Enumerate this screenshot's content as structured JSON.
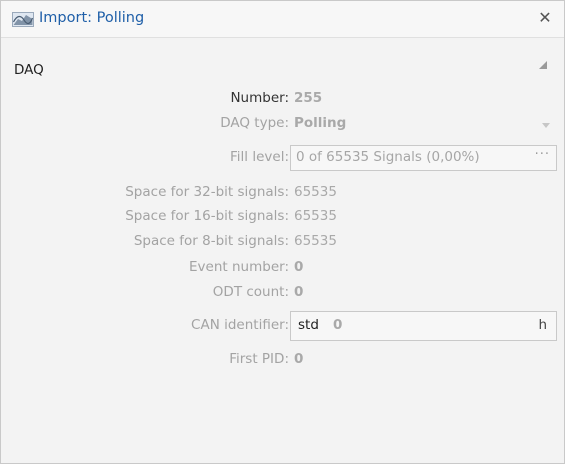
{
  "window": {
    "title": "Import: Polling",
    "close_icon": "close-icon",
    "title_icon": "import-waveform-icon"
  },
  "section": {
    "title": "DAQ",
    "collapse_icon": "collapse-triangle-icon"
  },
  "fields": {
    "number": {
      "label": "Number:",
      "value": "255"
    },
    "daq_type": {
      "label": "DAQ type:",
      "value": "Polling"
    },
    "fill_level": {
      "label": "Fill level:",
      "value": "0 of 65535 Signals (0,00%)",
      "button": "···"
    },
    "space32": {
      "label": "Space for 32-bit signals:",
      "value": "65535"
    },
    "space16": {
      "label": "Space for 16-bit signals:",
      "value": "65535"
    },
    "space8": {
      "label": "Space for 8-bit signals:",
      "value": "65535"
    },
    "event_number": {
      "label": "Event number:",
      "value": "0"
    },
    "odt_count": {
      "label": "ODT count:",
      "value": "0"
    },
    "can_identifier": {
      "label": "CAN identifier:",
      "prefix": "std",
      "value": "0",
      "suffix": "h"
    },
    "first_pid": {
      "label": "First PID:",
      "value": "0"
    }
  },
  "colors": {
    "title": "#1f5fa8",
    "label_disabled": "#a3a3a3",
    "value_disabled": "#a9a9a9",
    "background": "#f3f3f3"
  }
}
